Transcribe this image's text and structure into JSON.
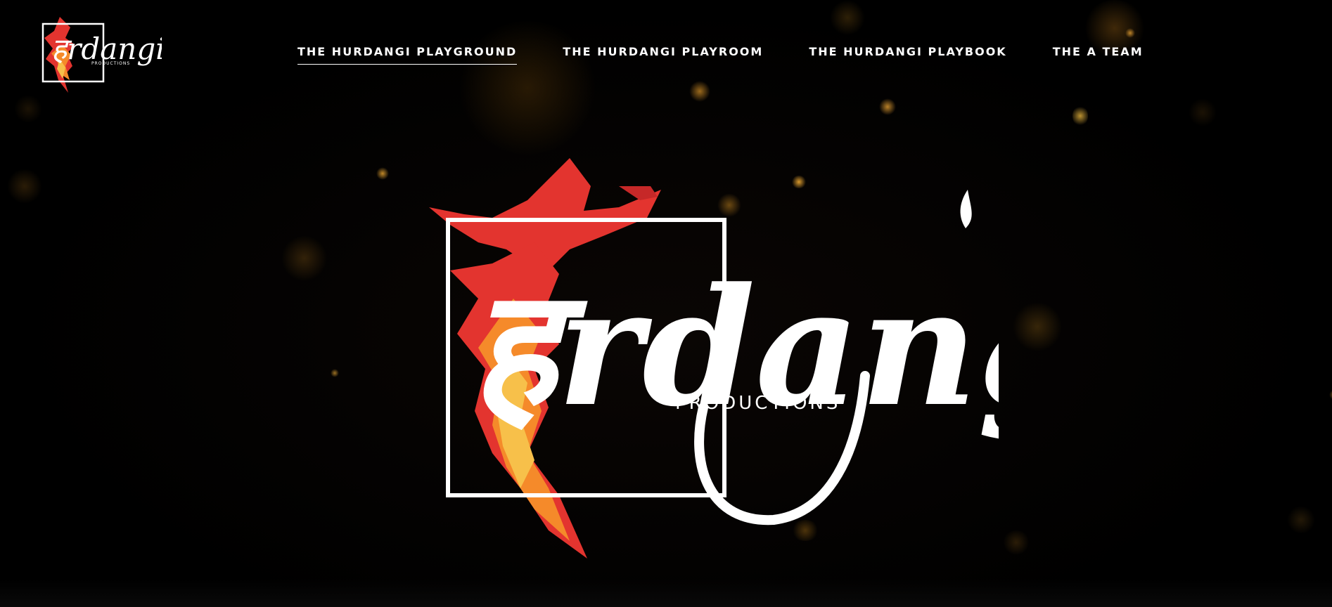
{
  "brand": {
    "wordmark_script": "हrdangi",
    "tagline": "PRODUCTIONS",
    "icon": "phoenix-icon"
  },
  "nav": {
    "items": [
      {
        "label": "THE HURDANGI PLAYGROUND",
        "active": true
      },
      {
        "label": "THE HURDANGI PLAYROOM",
        "active": false
      },
      {
        "label": "THE HURDANGI PLAYBOOK",
        "active": false
      },
      {
        "label": "THE A TEAM",
        "active": false
      }
    ]
  },
  "colors": {
    "background": "#000000",
    "accent_red": "#e3342f",
    "accent_orange": "#f58a2a",
    "accent_yellow": "#f7c04a",
    "text": "#ffffff",
    "bokeh": "#c98a1c"
  }
}
